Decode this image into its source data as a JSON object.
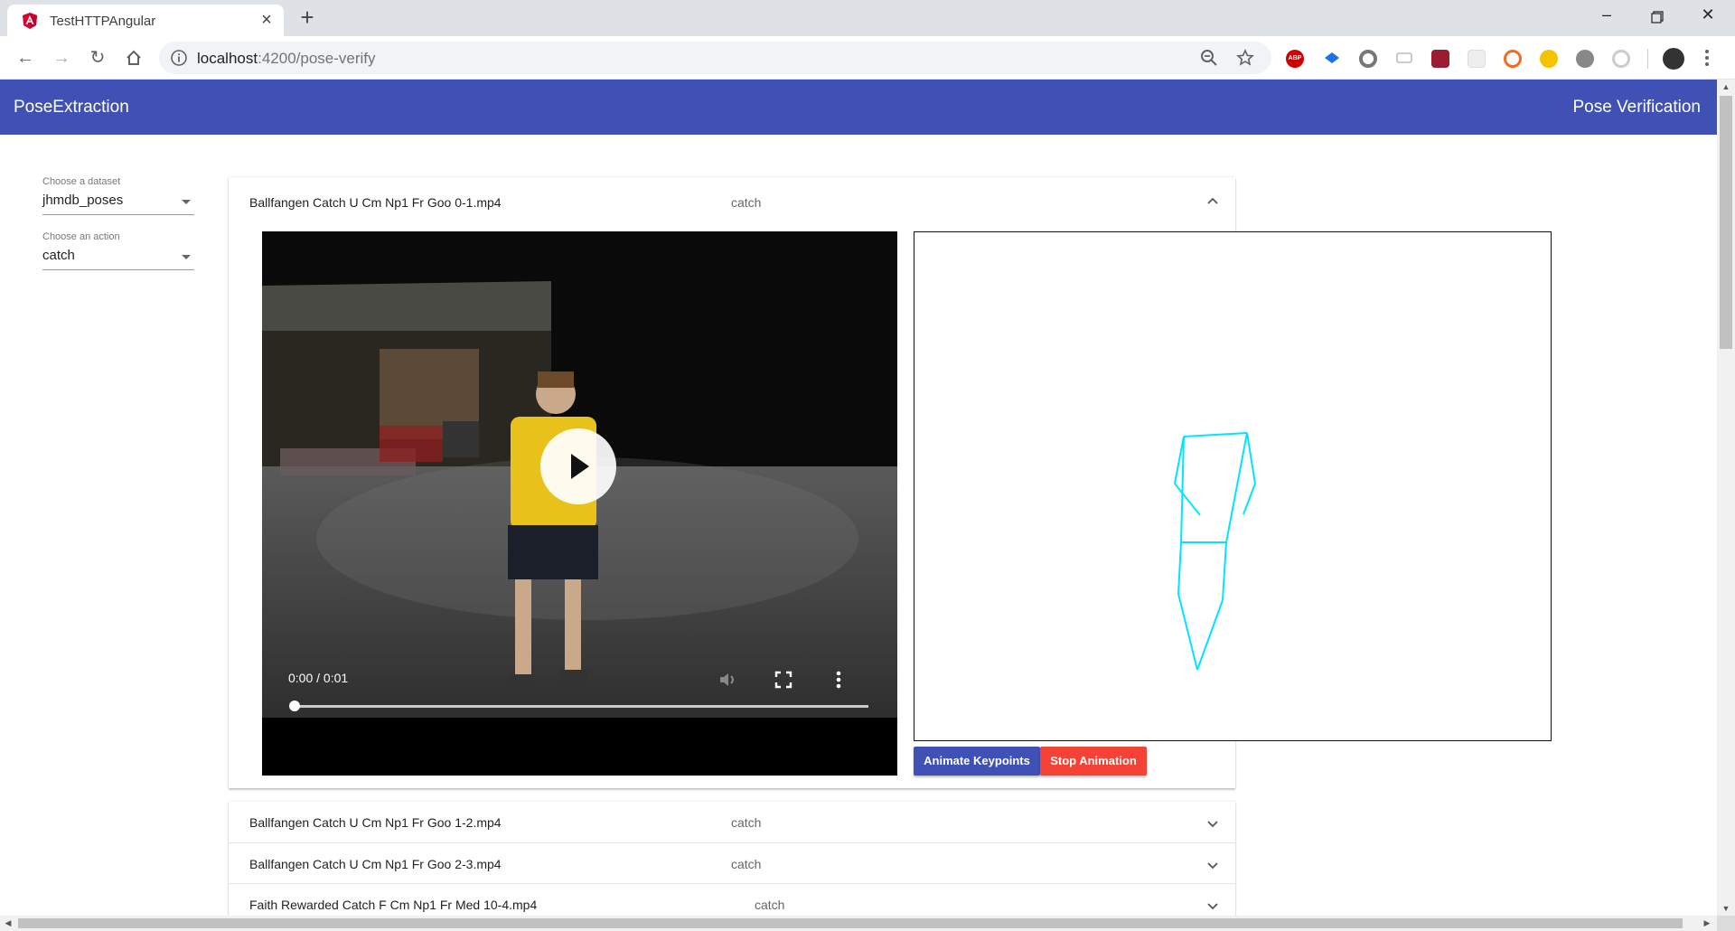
{
  "browser": {
    "tab_title": "TestHTTPAngular",
    "url_host": "localhost",
    "url_path": ":4200/pose-verify",
    "extensions": [
      "abp-icon",
      "bookmark-icon",
      "circle-icon",
      "chat-icon",
      "mendeley-icon",
      "blank-icon",
      "brave-icon",
      "moon-icon",
      "puzzle-icon",
      "clock-icon"
    ]
  },
  "app": {
    "brand": "PoseExtraction",
    "page_link": "Pose Verification"
  },
  "sidebar": {
    "dataset_label": "Choose a dataset",
    "dataset_value": "jhmdb_poses",
    "action_label": "Choose an action",
    "action_value": "catch"
  },
  "panels": [
    {
      "name": "Ballfangen Catch U Cm Np1 Fr Goo 0-1.mp4",
      "action": "catch",
      "expanded": true
    },
    {
      "name": "Ballfangen Catch U Cm Np1 Fr Goo 1-2.mp4",
      "action": "catch",
      "expanded": false
    },
    {
      "name": "Ballfangen Catch U Cm Np1 Fr Goo 2-3.mp4",
      "action": "catch",
      "expanded": false
    },
    {
      "name": "Faith Rewarded Catch F Cm Np1 Fr Med 10-4.mp4",
      "action": "catch",
      "expanded": false
    }
  ],
  "video": {
    "time": "0:00 / 0:01",
    "progress": 0
  },
  "buttons": {
    "animate": "Animate Keypoints",
    "stop": "Stop Animation"
  },
  "colors": {
    "primary": "#3f51b5",
    "warn": "#f44336",
    "skeleton": "#00e5ff"
  }
}
